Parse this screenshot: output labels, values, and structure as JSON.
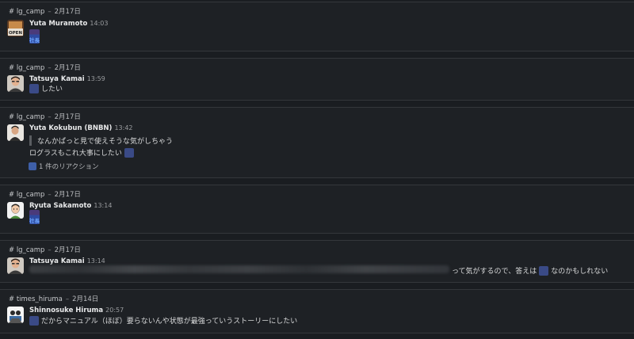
{
  "messages": [
    {
      "channel": "# lg_camp",
      "date": "2月17日",
      "author": "Yuta Muramoto",
      "time": "14:03",
      "avatar_label": "OPEN",
      "emoji_tag": "社長"
    },
    {
      "channel": "# lg_camp",
      "date": "2月17日",
      "author": "Tatsuya Kamai",
      "time": "13:59",
      "text": "したい"
    },
    {
      "channel": "# lg_camp",
      "date": "2月17日",
      "author": "Yuta Kokubun (BNBN)",
      "time": "13:42",
      "quote": "なんかぱっと見で使えそうな気がしちゃう",
      "text": "ログラスもこれ大事にしたい",
      "reaction": "1 件のリアクション"
    },
    {
      "channel": "# lg_camp",
      "date": "2月17日",
      "author": "Ryuta Sakamoto",
      "time": "13:14",
      "emoji_tag": "社長"
    },
    {
      "channel": "# lg_camp",
      "date": "2月17日",
      "author": "Tatsuya Kamai",
      "time": "13:14",
      "text_before": "って気がするので、答えは",
      "text_after": "なのかもしれない"
    },
    {
      "channel": "# times_hiruma",
      "date": "2月14日",
      "author": "Shinnosuke Hiruma",
      "time": "20:57",
      "text": "だからマニュアル（ほぼ）要らないんや状態が最強っていうストーリーにしたい"
    }
  ],
  "colors": {
    "background": "#1a1d21",
    "card": "#1e2125",
    "border": "#34373b",
    "emoji": "#3a4a86",
    "emoji_text": "#6fa8ff"
  }
}
